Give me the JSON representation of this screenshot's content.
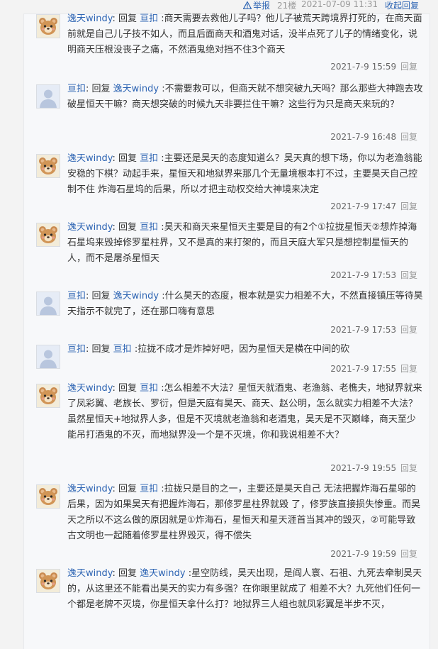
{
  "topbar": {
    "report_label": "举报",
    "floor": "21楼",
    "post_time": "2021-07-09 11:31",
    "collapse_label": "收起回复"
  },
  "reply_word": "回复",
  "replies": [
    {
      "author": "逸天windy",
      "target": "亘扣",
      "avatar": "bear",
      "text": ":商天需要去救他儿子吗？他儿子被荒天跨境界打死的，在商天面前就是自己儿子技不如人，而且后面商天和酒鬼对话，没半点死了儿子的情绪变化，说明商天压根没丧子之痛，不然酒鬼绝对挡不住3个商天",
      "time": "2021-7-9 15:59",
      "reply_label": "回复"
    },
    {
      "author": "亘扣",
      "target": "逸天windy",
      "avatar": "default",
      "text": ":不需要救可以，但商天就不想突破九天吗？那么那些大神跑去攻破星恒天干嘛？商天想突破的时候九天非要拦住干嘛？这些行为只是商天来玩的？",
      "time": "2021-7-9 16:48",
      "reply_label": "回复"
    },
    {
      "author": "逸天windy",
      "target": "亘扣",
      "avatar": "bear",
      "text": ":主要还是昊天的态度知道么？昊天真的想下场，你以为老渔翁能安稳的下棋？动起手来，星恒天和地狱界来那几个无量境根本打不过，主要昊天自己控制不住 炸海石星坞的后果，所以才把主动权交给大神境来决定",
      "time": "2021-7-9 17:47",
      "reply_label": "回复"
    },
    {
      "author": "逸天windy",
      "target": "亘扣",
      "avatar": "bear",
      "text": ":昊天和商天来星恒天主要是目的有2个①拉拢星恒天②想炸掉海石星坞来毁掉修罗星柱界，又不是真的来打架的，而且天庭大军只是想控制星恒天的人，而不是屠杀星恒天",
      "time": "2021-7-9 17:53",
      "reply_label": "回复"
    },
    {
      "author": "亘扣",
      "target": "逸天windy",
      "avatar": "default",
      "text": ":什么昊天的态度，根本就是实力相差不大，不然直接镇压等待昊天指示不就完了，还在那口嗨有意思",
      "time": "2021-7-9 17:53",
      "reply_label": "回复"
    },
    {
      "author": "亘扣",
      "target": "亘扣",
      "avatar": "default",
      "text": ":拉拢不成才是炸掉好吧，因为星恒天是横在中间的砍",
      "time": "2021-7-9 17:55",
      "reply_label": "回复"
    },
    {
      "author": "逸天windy",
      "target": "亘扣",
      "avatar": "bear",
      "text": ":怎么相差不大法？星恒天就酒鬼、老渔翁、老樵夫，地狱界就来了凤彩翼、老族长、罗衍，但是天庭有昊天、商天、赵公明，怎么就实力相差不大法？虽然星恒天+地狱界人多，但是不灭境就老渔翁和老酒鬼，昊天是不灭巅峰，商天至少能吊打酒鬼的不灭，而地狱界没一个是不灭境，你和我说相差不大？",
      "time": "2021-7-9 19:55",
      "reply_label": "回复"
    },
    {
      "author": "逸天windy",
      "target": "亘扣",
      "avatar": "bear",
      "text": ":拉拢只是目的之一，主要还是昊天自己 无法把握炸海石星邬的后果，因为如果昊天有把握炸海石，那修罗星柱界就毁 了，修罗族直接损失惨重。而昊天之所以不这么做的原因就是①炸海石，星恒天和星天涯首当其冲的毁灭，②可能导致古文明也一起随着修罗星柱界毁灭，得不偿失",
      "time": "2021-7-9 19:59",
      "reply_label": "回复"
    },
    {
      "author": "逸天windy",
      "target": "逸天windy",
      "avatar": "bear",
      "text": ":星空防线，昊天出现，是阎人寰、石祖、九死去牵制昊天的，从这里还不能看出昊天的实力有多强？在你眼里就成了 相差不大？九死他们任何一个都是老牌不灭境，你星恒天拿什么打？地狱界三人组也就凤彩翼是半步不灭，",
      "time": "",
      "reply_label": ""
    }
  ]
}
